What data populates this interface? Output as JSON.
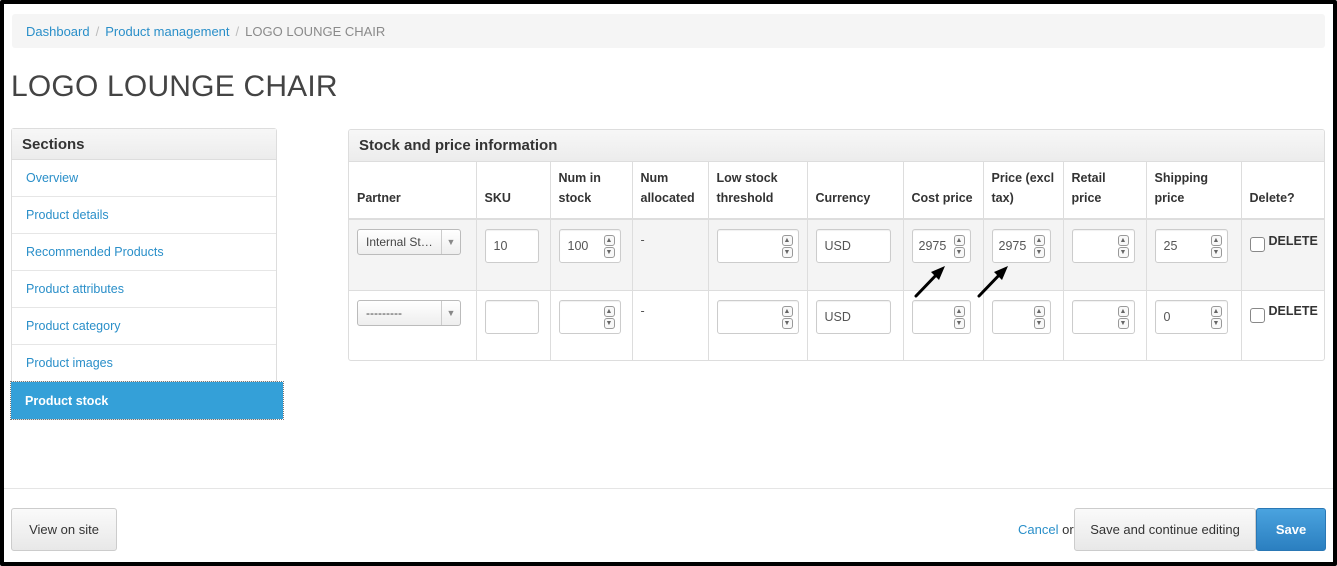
{
  "breadcrumb": {
    "dashboard": "Dashboard",
    "product_management": "Product management",
    "current": "LOGO LOUNGE CHAIR"
  },
  "page_title": "LOGO LOUNGE CHAIR",
  "sidebar": {
    "title": "Sections",
    "items": [
      {
        "label": "Overview"
      },
      {
        "label": "Product details"
      },
      {
        "label": "Recommended Products"
      },
      {
        "label": "Product attributes"
      },
      {
        "label": "Product category"
      },
      {
        "label": "Product images"
      },
      {
        "label": "Product stock",
        "active": true
      }
    ]
  },
  "stock": {
    "title": "Stock and price information",
    "columns": {
      "partner": "Partner",
      "sku": "SKU",
      "num_in_stock": "Num in stock",
      "num_allocated": "Num allocated",
      "low_stock": "Low stock threshold",
      "currency": "Currency",
      "cost_price": "Cost price",
      "price_excl_tax": "Price (excl tax)",
      "retail_price": "Retail price",
      "shipping_price": "Shipping price",
      "delete": "Delete?"
    },
    "rows": [
      {
        "partner": "Internal St…",
        "sku": "10",
        "num_in_stock": "100",
        "num_allocated": "-",
        "low_stock": "",
        "currency": "USD",
        "cost_price": "2975",
        "price_excl_tax": "2975",
        "retail_price": "",
        "shipping_price": "25",
        "delete_label": "DELETE"
      },
      {
        "partner": "---------",
        "sku": "",
        "num_in_stock": "",
        "num_allocated": "-",
        "low_stock": "",
        "currency": "USD",
        "cost_price": "",
        "price_excl_tax": "",
        "retail_price": "",
        "shipping_price": "0",
        "delete_label": "DELETE"
      }
    ]
  },
  "footer": {
    "view_on_site": "View on site",
    "cancel": "Cancel",
    "or": "or",
    "save_continue": "Save and continue editing",
    "save": "Save"
  },
  "colors": {
    "link": "#2a8fc9",
    "active_bg": "#34a0d8",
    "save_button": "#2b7fc0"
  },
  "icons": [
    "spinner-up-icon",
    "spinner-down-icon",
    "dropdown-caret-icon",
    "arrow-annotation-icon"
  ]
}
